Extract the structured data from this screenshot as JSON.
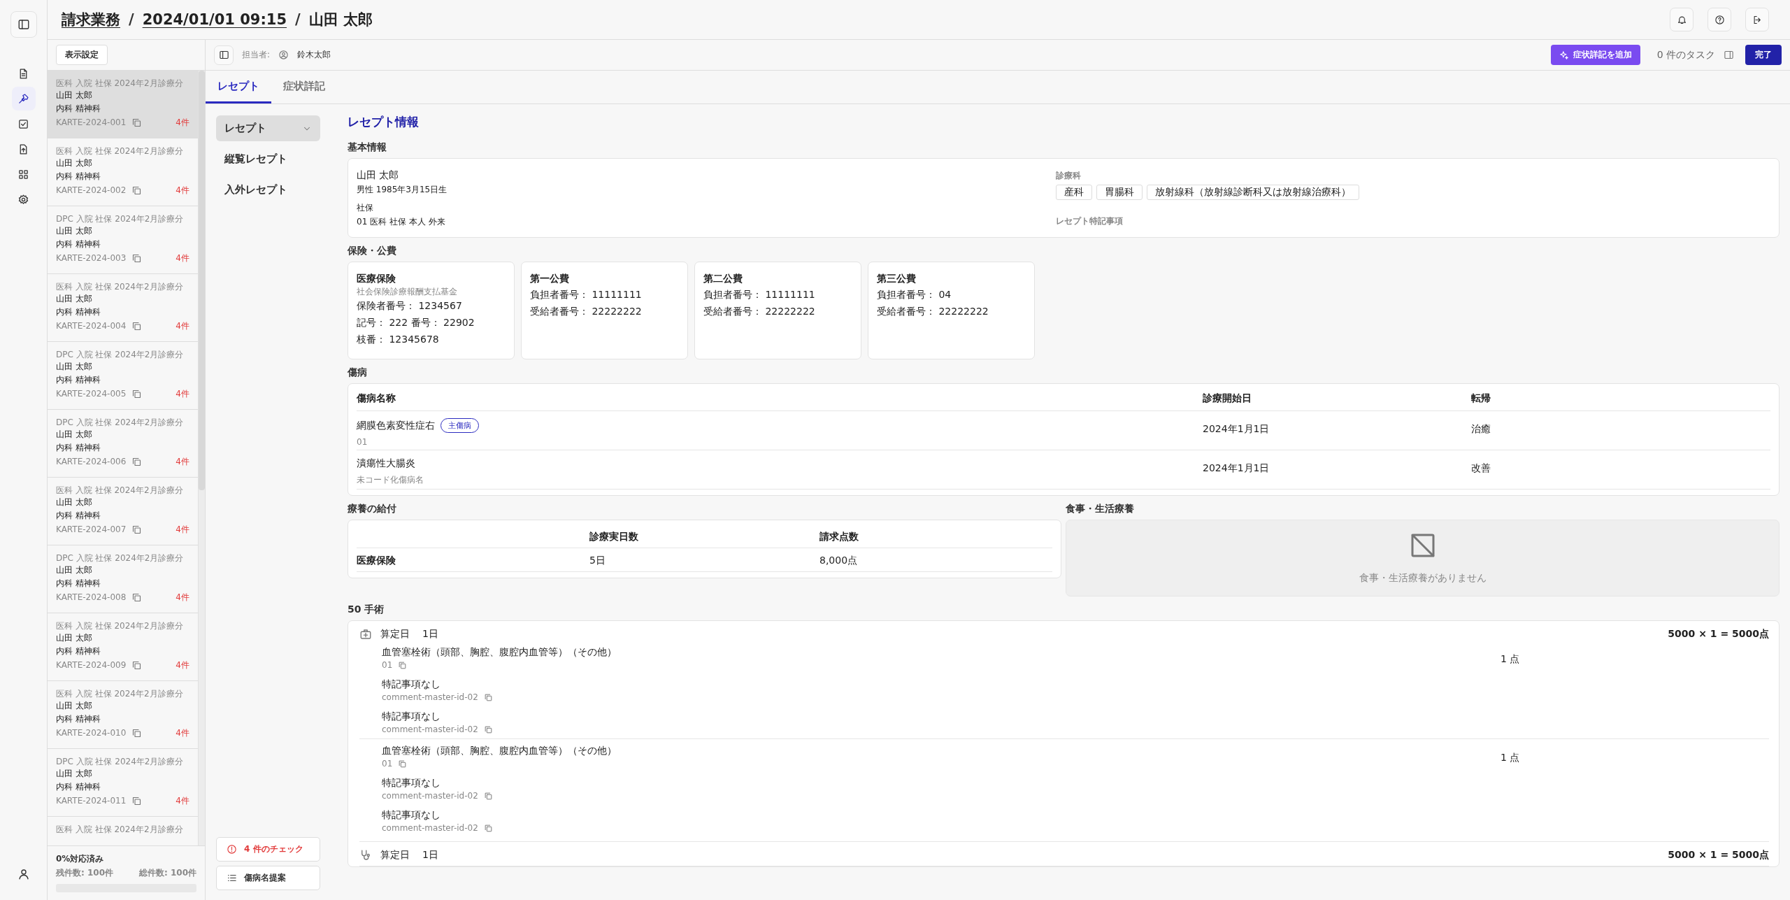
{
  "header": {
    "breadcrumb": [
      {
        "label": "請求業務",
        "link": true
      },
      {
        "label": "2024/01/01 09:15",
        "link": true
      },
      {
        "label": "山田 太郎",
        "link": false
      }
    ],
    "separator": "/"
  },
  "list_panel": {
    "settings_button": "表示設定",
    "items": [
      {
        "header": "医科 入院 社保 2024年2月診療分",
        "name": "山田 太郎",
        "departments": "内科 精神科",
        "id": "KARTE-2024-001",
        "count": "4件",
        "selected": true
      },
      {
        "header": "医科 入院 社保 2024年2月診療分",
        "name": "山田 太郎",
        "departments": "内科 精神科",
        "id": "KARTE-2024-002",
        "count": "4件",
        "selected": false
      },
      {
        "header": "DPC 入院 社保 2024年2月診療分",
        "name": "山田 太郎",
        "departments": "内科 精神科",
        "id": "KARTE-2024-003",
        "count": "4件",
        "selected": false
      },
      {
        "header": "医科 入院 社保 2024年2月診療分",
        "name": "山田 太郎",
        "departments": "内科 精神科",
        "id": "KARTE-2024-004",
        "count": "4件",
        "selected": false
      },
      {
        "header": "DPC 入院 社保 2024年2月診療分",
        "name": "山田 太郎",
        "departments": "内科 精神科",
        "id": "KARTE-2024-005",
        "count": "4件",
        "selected": false
      },
      {
        "header": "DPC 入院 社保 2024年2月診療分",
        "name": "山田 太郎",
        "departments": "内科 精神科",
        "id": "KARTE-2024-006",
        "count": "4件",
        "selected": false
      },
      {
        "header": "医科 入院 社保 2024年2月診療分",
        "name": "山田 太郎",
        "departments": "内科 精神科",
        "id": "KARTE-2024-007",
        "count": "4件",
        "selected": false
      },
      {
        "header": "DPC 入院 社保 2024年2月診療分",
        "name": "山田 太郎",
        "departments": "内科 精神科",
        "id": "KARTE-2024-008",
        "count": "4件",
        "selected": false
      },
      {
        "header": "医科 入院 社保 2024年2月診療分",
        "name": "山田 太郎",
        "departments": "内科 精神科",
        "id": "KARTE-2024-009",
        "count": "4件",
        "selected": false
      },
      {
        "header": "医科 入院 社保 2024年2月診療分",
        "name": "山田 太郎",
        "departments": "内科 精神科",
        "id": "KARTE-2024-010",
        "count": "4件",
        "selected": false
      },
      {
        "header": "DPC 入院 社保 2024年2月診療分",
        "name": "山田 太郎",
        "departments": "内科 精神科",
        "id": "KARTE-2024-011",
        "count": "4件",
        "selected": false
      },
      {
        "header": "医科 入院 社保 2024年2月診療分",
        "selected": false
      }
    ],
    "footer": {
      "progress_label": "0%対応済み",
      "remaining": "残件数: 100件",
      "total": "総件数: 100件",
      "level": 0
    }
  },
  "toolbar": {
    "assignee_label": "担当者:",
    "assignee": "鈴木太郎",
    "add_button": "症状詳記を追加",
    "tasks": "0 件のタスク",
    "done_button": "完了"
  },
  "tabs": [
    {
      "label": "レセプト",
      "selected": true
    },
    {
      "label": "症状詳記",
      "selected": false
    }
  ],
  "side_nav": {
    "items": [
      {
        "label": "レセプト",
        "selected": true,
        "has_menu": true
      },
      {
        "label": "縦覧レセプト",
        "selected": false,
        "has_menu": false
      },
      {
        "label": "入外レセプト",
        "selected": false,
        "has_menu": false
      }
    ],
    "check_button": "4 件のチェック",
    "suggest_button": "傷病名提案"
  },
  "receipt": {
    "title": "レセプト情報",
    "basic": {
      "title": "基本情報",
      "name": "山田 太郎",
      "profile": "男性 1985年3月15日生",
      "insurance_label": "社保",
      "insurance": "01 医科 社保 本人 外来",
      "department_label": "診療科",
      "departments": [
        "産科",
        "胃腸科",
        "放射線科（放射線診断科又は放射線治療科）"
      ],
      "notes_label": "レセプト特記事項"
    },
    "insurance": {
      "title": "保険・公費",
      "cards": [
        {
          "title": "医療保険",
          "subtitle": "社会保険診療報酬支払基金",
          "lines": [
            "保険者番号： 1234567",
            "記号： 222  番号： 22902",
            "枝番： 12345678"
          ]
        },
        {
          "title": "第一公費",
          "lines": [
            "負担者番号： 11111111",
            "受給者番号： 22222222"
          ]
        },
        {
          "title": "第二公費",
          "lines": [
            "負担者番号： 11111111",
            "受給者番号： 22222222"
          ]
        },
        {
          "title": "第三公費",
          "lines": [
            "負担者番号： 04",
            "受給者番号： 22222222"
          ]
        }
      ]
    },
    "diseases": {
      "title": "傷病",
      "columns": [
        "傷病名称",
        "診療開始日",
        "転帰"
      ],
      "rows": [
        {
          "name": "網膜色素変性症右",
          "badge": "主傷病",
          "sub": "01",
          "start": "2024年1月1日",
          "outcome": "治癒"
        },
        {
          "name": "潰瘍性大腸炎",
          "sub": "未コード化傷病名",
          "start": "2024年1月1日",
          "outcome": "改善"
        }
      ]
    },
    "benefits": {
      "title": "療養の給付",
      "columns": [
        "診療実日数",
        "請求点数"
      ],
      "rows": [
        {
          "label": "医療保険",
          "days": "5日",
          "points": "8,000点"
        }
      ]
    },
    "meals": {
      "title": "食事・生活療養",
      "empty_text": "食事・生活療養がありません"
    },
    "procedures": {
      "title": "50 手術",
      "groups": [
        {
          "kind": "treatment",
          "date_label": "算定日",
          "date": "1日",
          "total": "5000 × 1 = 5000点",
          "items": [
            {
              "name": "血管塞栓術（頭部、胸腔、腹腔内血管等）（その他）",
              "code": "01",
              "points": "1 点",
              "comments": [
                {
                  "text": "特記事項なし",
                  "code": "comment-master-id-02"
                },
                {
                  "text": "特記事項なし",
                  "code": "comment-master-id-02"
                }
              ]
            },
            {
              "name": "血管塞栓術（頭部、胸腔、腹腔内血管等）（その他）",
              "code": "01",
              "points": "1 点",
              "comments": [
                {
                  "text": "特記事項なし",
                  "code": "comment-master-id-02"
                },
                {
                  "text": "特記事項なし",
                  "code": "comment-master-id-02"
                }
              ]
            }
          ]
        },
        {
          "kind": "consultation",
          "date_label": "算定日",
          "date": "1日",
          "total": "5000 × 1 = 5000点"
        }
      ]
    }
  }
}
